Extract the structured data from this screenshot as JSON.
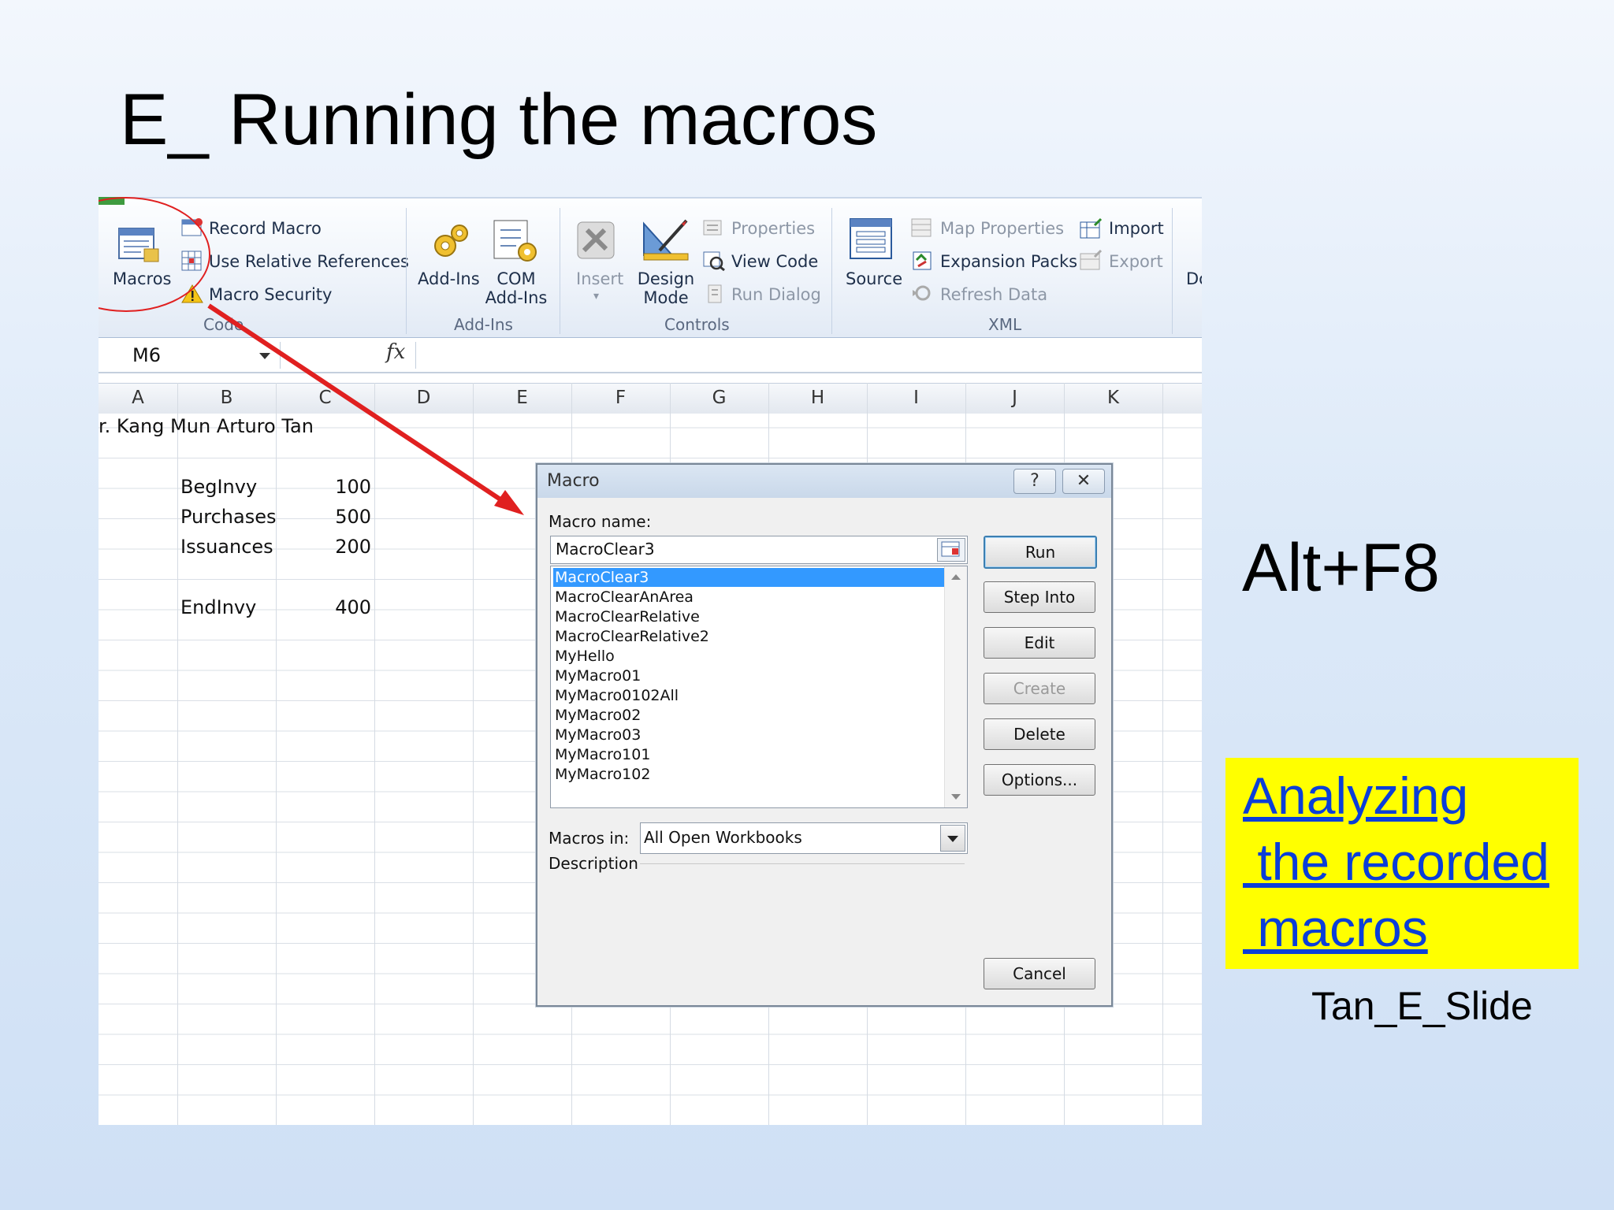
{
  "slide": {
    "title": "E_ Running the macros",
    "shortcut": "Alt+F8",
    "link_text": "Analyzing\n the recorded\n macros",
    "footer": "Tan_E_Slide"
  },
  "ribbon": {
    "code_group": {
      "macros_label": "Macros",
      "record_macro": "Record Macro",
      "use_relative": "Use Relative References",
      "macro_security": "Macro Security",
      "group_label": "Code"
    },
    "addins_group": {
      "addins_label": "Add-Ins",
      "com_addins_line1": "COM",
      "com_addins_line2": "Add-Ins",
      "group_label": "Add-Ins"
    },
    "controls_group": {
      "insert_label": "Insert",
      "design_mode_line1": "Design",
      "design_mode_line2": "Mode",
      "properties": "Properties",
      "view_code": "View Code",
      "run_dialog": "Run Dialog",
      "group_label": "Controls"
    },
    "xml_group": {
      "source_label": "Source",
      "map_properties": "Map Properties",
      "expansion_packs": "Expansion Packs",
      "refresh_data": "Refresh Data",
      "import": "Import",
      "export": "Export",
      "group_label": "XML"
    },
    "cut_off_label": "Do"
  },
  "formula_bar": {
    "name_box": "M6",
    "fx": "fx"
  },
  "sheet": {
    "columns": [
      "A",
      "B",
      "C",
      "D",
      "E",
      "F",
      "G",
      "H",
      "I",
      "J",
      "K"
    ],
    "a1_text": "r. Kang Mun Arturo Tan",
    "rows": [
      {
        "label": "BegInvy",
        "value": "100"
      },
      {
        "label": "Purchases",
        "value": "500"
      },
      {
        "label": "Issuances",
        "value": "200"
      },
      {
        "label": "EndInvy",
        "value": "400"
      }
    ]
  },
  "dialog": {
    "title": "Macro",
    "help_btn": "?",
    "close_btn": "✕",
    "macro_name_label": "Macro name:",
    "macro_name_value": "MacroClear3",
    "macros": [
      "MacroClear3",
      "MacroClearAnArea",
      "MacroClearRelative",
      "MacroClearRelative2",
      "MyHello",
      "MyMacro01",
      "MyMacro0102All",
      "MyMacro02",
      "MyMacro03",
      "MyMacro101",
      "MyMacro102"
    ],
    "selected_index": 0,
    "buttons": {
      "run": "Run",
      "step_into": "Step Into",
      "edit": "Edit",
      "create": "Create",
      "delete": "Delete",
      "options": "Options...",
      "cancel": "Cancel"
    },
    "macros_in_label": "Macros in:",
    "macros_in_value": "All Open Workbooks",
    "description_label": "Description"
  },
  "colors": {
    "annotation_red": "#e02020",
    "link_blue": "#0b3ed8",
    "link_bg": "#ffff00",
    "selection_blue": "#3399ff"
  }
}
